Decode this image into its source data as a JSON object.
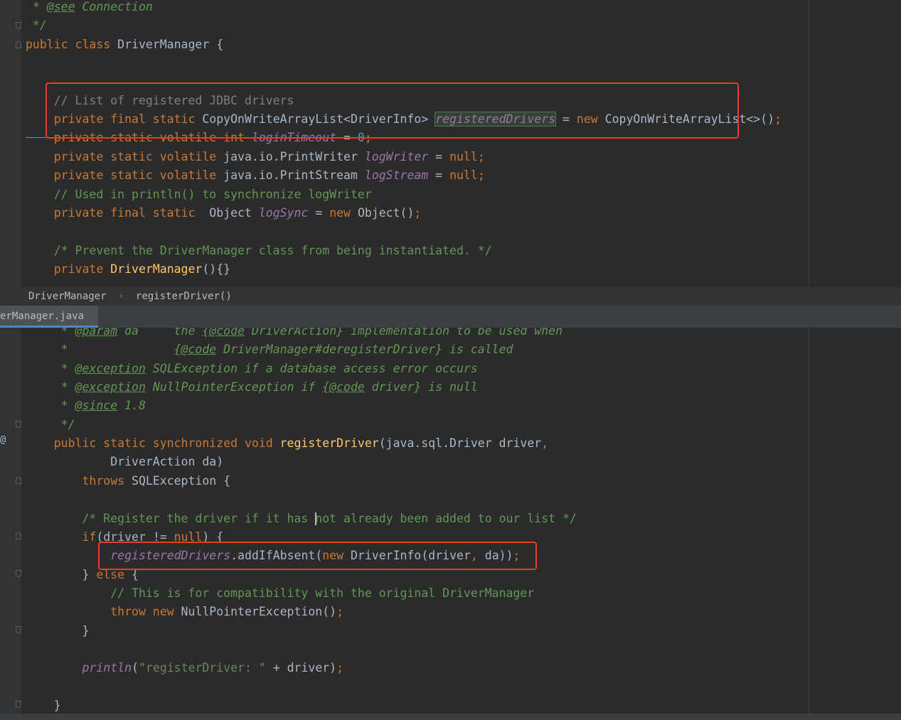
{
  "top_editor": {
    "lines": [
      [
        {
          "t": " * ",
          "c": "cm"
        },
        {
          "t": "@see",
          "c": "tag"
        },
        {
          "t": " Connection",
          "c": "cm"
        }
      ],
      [
        {
          "t": " */",
          "c": "cm"
        }
      ],
      [
        {
          "t": "public class ",
          "c": "kw"
        },
        {
          "t": "DriverManager {",
          "c": ""
        }
      ],
      [],
      [],
      [
        {
          "t": "    // List of registered JDBC drivers",
          "c": "lc"
        }
      ],
      [
        {
          "t": "    private final static ",
          "c": "kw"
        },
        {
          "t": "CopyOnWriteArrayList<DriverInfo> ",
          "c": ""
        },
        {
          "t": "registeredDrivers",
          "c": "fld hl"
        },
        {
          "t": " = ",
          "c": ""
        },
        {
          "t": "new ",
          "c": "kw"
        },
        {
          "t": "CopyOnWriteArrayList<>()",
          "c": ""
        },
        {
          "t": ";",
          "c": "kw"
        }
      ],
      [
        {
          "t": "    private static volatile int ",
          "c": "kw strike"
        },
        {
          "t": "loginTimeout",
          "c": "fld strike"
        },
        {
          "t": " = ",
          "c": "strike"
        },
        {
          "t": "0",
          "c": "num strike"
        },
        {
          "t": ";",
          "c": "kw strike"
        }
      ],
      [
        {
          "t": "    private static volatile ",
          "c": "kw"
        },
        {
          "t": "java.io.PrintWriter ",
          "c": ""
        },
        {
          "t": "logWriter",
          "c": "fld"
        },
        {
          "t": " = ",
          "c": ""
        },
        {
          "t": "null",
          "c": "kw"
        },
        {
          "t": ";",
          "c": "kw"
        }
      ],
      [
        {
          "t": "    private static volatile ",
          "c": "kw"
        },
        {
          "t": "java.io.PrintStream ",
          "c": ""
        },
        {
          "t": "logStream",
          "c": "fld"
        },
        {
          "t": " = ",
          "c": ""
        },
        {
          "t": "null",
          "c": "kw"
        },
        {
          "t": ";",
          "c": "kw"
        }
      ],
      [
        {
          "t": "    // Used in println() to synchronize logWriter",
          "c": "gc"
        }
      ],
      [
        {
          "t": "    private final static  ",
          "c": "kw"
        },
        {
          "t": "Object ",
          "c": ""
        },
        {
          "t": "logSync",
          "c": "fld"
        },
        {
          "t": " = ",
          "c": ""
        },
        {
          "t": "new ",
          "c": "kw"
        },
        {
          "t": "Object()",
          "c": ""
        },
        {
          "t": ";",
          "c": "kw"
        }
      ],
      [],
      [
        {
          "t": "    /* Prevent the DriverManager class from being instantiated. */",
          "c": "gc"
        }
      ],
      [
        {
          "t": "    private ",
          "c": "kw"
        },
        {
          "t": "DriverManager",
          "c": "fn"
        },
        {
          "t": "(){}",
          "c": ""
        }
      ]
    ]
  },
  "breadcrumb": {
    "items": [
      "DriverManager",
      "registerDriver()"
    ],
    "separator": "›"
  },
  "tab": {
    "label": "erManager.java",
    "close": "×"
  },
  "bottom_editor": {
    "lines": [
      [
        {
          "t": "     * ",
          "c": "cm"
        },
        {
          "t": "@param",
          "c": "tag"
        },
        {
          "t": " da     the ",
          "c": "cm"
        },
        {
          "t": "{@code",
          "c": "tag"
        },
        {
          "t": " DriverAction} implementation to be used when",
          "c": "cm"
        }
      ],
      [
        {
          "t": "     *               ",
          "c": "cm"
        },
        {
          "t": "{@code",
          "c": "tag"
        },
        {
          "t": " DriverManager#deregisterDriver} is called",
          "c": "cm"
        }
      ],
      [
        {
          "t": "     * ",
          "c": "cm"
        },
        {
          "t": "@exception",
          "c": "tag"
        },
        {
          "t": " SQLException if a database access error occurs",
          "c": "cm"
        }
      ],
      [
        {
          "t": "     * ",
          "c": "cm"
        },
        {
          "t": "@exception",
          "c": "tag"
        },
        {
          "t": " NullPointerException if ",
          "c": "cm"
        },
        {
          "t": "{@code",
          "c": "tag"
        },
        {
          "t": " driver} is null",
          "c": "cm"
        }
      ],
      [
        {
          "t": "     * ",
          "c": "cm"
        },
        {
          "t": "@since",
          "c": "tag"
        },
        {
          "t": " 1.8",
          "c": "cm"
        }
      ],
      [
        {
          "t": "     */",
          "c": "cm"
        }
      ],
      [
        {
          "t": "    public static synchronized void ",
          "c": "kw"
        },
        {
          "t": "registerDriver",
          "c": "fn"
        },
        {
          "t": "(java.sql.Driver driver",
          "c": ""
        },
        {
          "t": ",",
          "c": "kw"
        }
      ],
      [
        {
          "t": "            DriverAction da)",
          "c": ""
        }
      ],
      [
        {
          "t": "        throws ",
          "c": "kw"
        },
        {
          "t": "SQLException {",
          "c": ""
        }
      ],
      [],
      [
        {
          "t": "        /* Register the driver if it has ",
          "c": "gc"
        },
        {
          "t": "",
          "c": "caret"
        },
        {
          "t": "not already been added to our list */",
          "c": "gc"
        }
      ],
      [
        {
          "t": "        if",
          "c": "kw"
        },
        {
          "t": "(driver != ",
          "c": ""
        },
        {
          "t": "null",
          "c": "kw"
        },
        {
          "t": ") {",
          "c": ""
        }
      ],
      [
        {
          "t": "            ",
          "c": ""
        },
        {
          "t": "registeredDrivers",
          "c": "fld"
        },
        {
          "t": ".addIfAbsent(",
          "c": ""
        },
        {
          "t": "new ",
          "c": "kw"
        },
        {
          "t": "DriverInfo(driver",
          "c": ""
        },
        {
          "t": ", ",
          "c": "kw"
        },
        {
          "t": "da))",
          "c": ""
        },
        {
          "t": ";",
          "c": "kw"
        }
      ],
      [
        {
          "t": "        } ",
          "c": ""
        },
        {
          "t": "else ",
          "c": "kw"
        },
        {
          "t": "{",
          "c": ""
        }
      ],
      [
        {
          "t": "            // This is for compatibility with the original DriverManager",
          "c": "gc"
        }
      ],
      [
        {
          "t": "            throw new ",
          "c": "kw"
        },
        {
          "t": "NullPointerException()",
          "c": ""
        },
        {
          "t": ";",
          "c": "kw"
        }
      ],
      [
        {
          "t": "        }",
          "c": ""
        }
      ],
      [],
      [
        {
          "t": "        ",
          "c": ""
        },
        {
          "t": "println",
          "c": "fld"
        },
        {
          "t": "(",
          "c": ""
        },
        {
          "t": "\"registerDriver: \"",
          "c": "str"
        },
        {
          "t": " + driver)",
          "c": ""
        },
        {
          "t": ";",
          "c": "kw"
        }
      ],
      [],
      [
        {
          "t": "    }",
          "c": ""
        }
      ]
    ]
  },
  "gutter": {
    "override_marker": "@"
  }
}
